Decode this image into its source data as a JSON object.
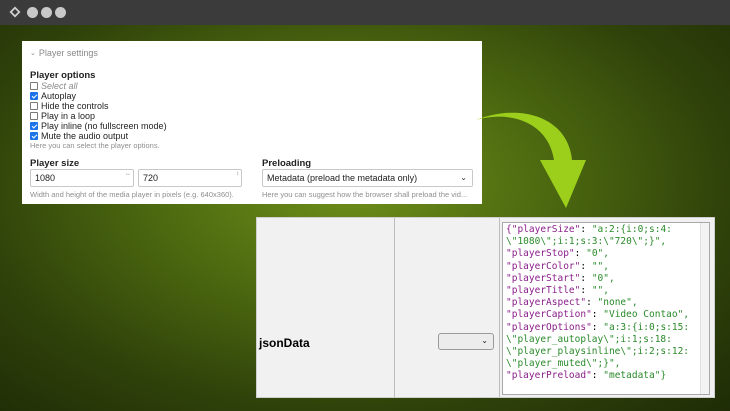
{
  "window": {
    "controls": [
      "close",
      "minimize",
      "maximize"
    ],
    "app_icon": "app-logo-icon"
  },
  "player_settings": {
    "legend": "Player settings",
    "options_title": "Player options",
    "options": [
      {
        "label": "Select all",
        "checked": false
      },
      {
        "label": "Autoplay",
        "checked": true
      },
      {
        "label": "Hide the controls",
        "checked": false
      },
      {
        "label": "Play in a loop",
        "checked": false
      },
      {
        "label": "Play inline (no fullscreen mode)",
        "checked": true
      },
      {
        "label": "Mute the audio output",
        "checked": true
      }
    ],
    "options_hint": "Here you can select the player options.",
    "size_title": "Player size",
    "width_value": "1080",
    "height_value": "720",
    "size_hint": "Width and height of the media player in pixels (e.g. 640x360).",
    "preload_title": "Preloading",
    "preload_value": "Metadata (preload the metadata only)",
    "preload_hint": "Here you can suggest how the browser shall preload the vid..."
  },
  "db_row": {
    "field_name": "jsonData",
    "select_value": "",
    "json_lines": [
      {
        "k": "{\"playerSize\"",
        "v": "\"a:2:{i:0;s:4:"
      },
      {
        "k": "",
        "v": "\\\"1080\\\";i:1;s:3:\\\"720\\\";}\","
      },
      {
        "k": "\"playerStop\"",
        "v": "\"0\","
      },
      {
        "k": "\"playerColor\"",
        "v": "\"\","
      },
      {
        "k": "\"playerStart\"",
        "v": "\"0\","
      },
      {
        "k": "\"playerTitle\"",
        "v": "\"\","
      },
      {
        "k": "\"playerAspect\"",
        "v": "\"none\","
      },
      {
        "k": "\"playerCaption\"",
        "v": "\"Video Contao\","
      },
      {
        "k": "\"playerOptions\"",
        "v": "\"a:3:{i:0;s:15:"
      },
      {
        "k": "",
        "v": "\\\"player_autoplay\\\";i:1;s:18:"
      },
      {
        "k": "",
        "v": "\\\"player_playsinline\\\";i:2;s:12:"
      },
      {
        "k": "",
        "v": "\\\"player_muted\\\";}\","
      },
      {
        "k": "\"playerPreload\"",
        "v": "\"metadata\"}"
      }
    ]
  },
  "colors": {
    "accent_check": "#1a73e8",
    "arrow": "#9ccf1c",
    "json_key": "#8a1e8a",
    "json_string": "#2a8a2a"
  }
}
